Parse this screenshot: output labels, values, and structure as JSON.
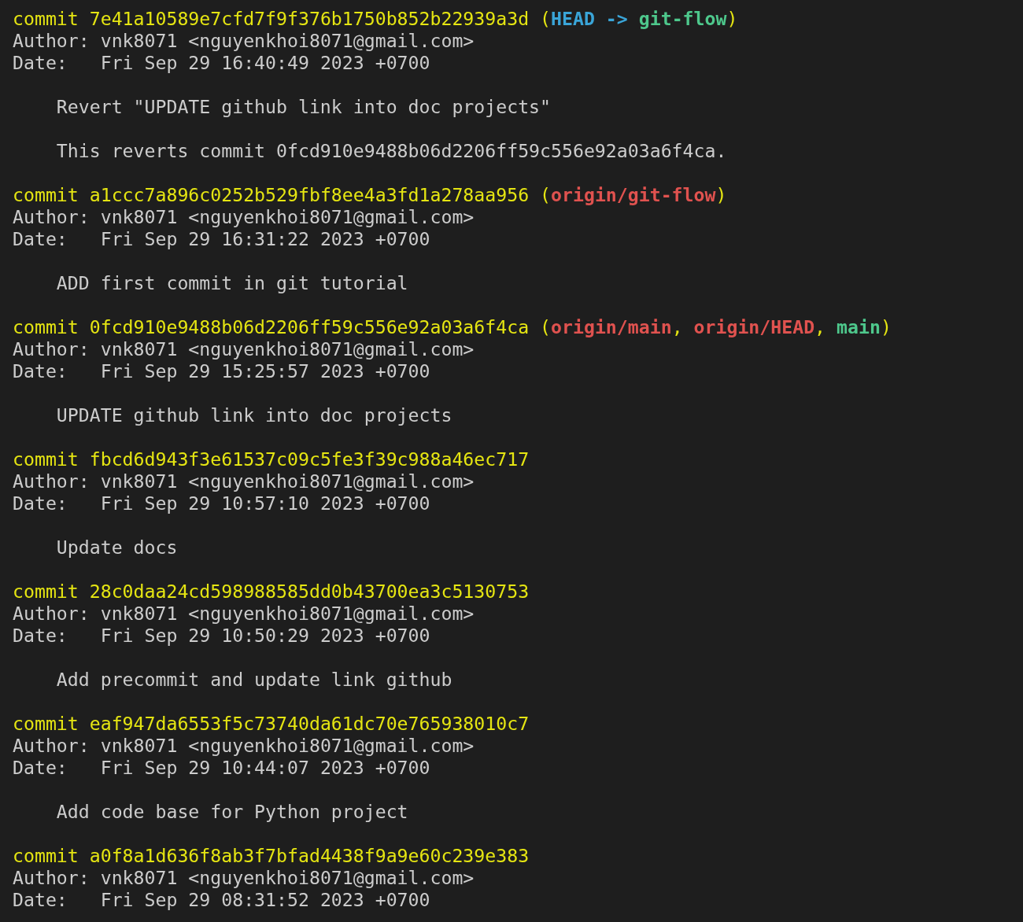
{
  "commits": [
    {
      "header": [
        {
          "kind": "hash",
          "text": "commit 7e41a10589e7cfd7f9f376b1750b852b22939a3d "
        },
        {
          "kind": "punct",
          "text": "("
        },
        {
          "kind": "head",
          "text": "HEAD -> "
        },
        {
          "kind": "local",
          "text": "git-flow"
        },
        {
          "kind": "punct",
          "text": ")"
        }
      ],
      "author": "Author: vnk8071 <nguyenkhoi8071@gmail.com>",
      "date": "Date:   Fri Sep 29 16:40:49 2023 +0700",
      "message": [
        "Revert \"UPDATE github link into doc projects\"",
        "This reverts commit 0fcd910e9488b06d2206ff59c556e92a03a6f4ca."
      ]
    },
    {
      "header": [
        {
          "kind": "hash",
          "text": "commit a1ccc7a896c0252b529fbf8ee4a3fd1a278aa956 "
        },
        {
          "kind": "punct",
          "text": "("
        },
        {
          "kind": "remote",
          "text": "origin/git-flow"
        },
        {
          "kind": "punct",
          "text": ")"
        }
      ],
      "author": "Author: vnk8071 <nguyenkhoi8071@gmail.com>",
      "date": "Date:   Fri Sep 29 16:31:22 2023 +0700",
      "message": [
        "ADD first commit in git tutorial"
      ]
    },
    {
      "header": [
        {
          "kind": "hash",
          "text": "commit 0fcd910e9488b06d2206ff59c556e92a03a6f4ca "
        },
        {
          "kind": "punct",
          "text": "("
        },
        {
          "kind": "remote",
          "text": "origin/main"
        },
        {
          "kind": "punct",
          "text": ", "
        },
        {
          "kind": "remote",
          "text": "origin/HEAD"
        },
        {
          "kind": "punct",
          "text": ", "
        },
        {
          "kind": "local",
          "text": "main"
        },
        {
          "kind": "punct",
          "text": ")"
        }
      ],
      "author": "Author: vnk8071 <nguyenkhoi8071@gmail.com>",
      "date": "Date:   Fri Sep 29 15:25:57 2023 +0700",
      "message": [
        "UPDATE github link into doc projects"
      ]
    },
    {
      "header": [
        {
          "kind": "hash",
          "text": "commit fbcd6d943f3e61537c09c5fe3f39c988a46ec717"
        }
      ],
      "author": "Author: vnk8071 <nguyenkhoi8071@gmail.com>",
      "date": "Date:   Fri Sep 29 10:57:10 2023 +0700",
      "message": [
        "Update docs"
      ]
    },
    {
      "header": [
        {
          "kind": "hash",
          "text": "commit 28c0daa24cd598988585dd0b43700ea3c5130753"
        }
      ],
      "author": "Author: vnk8071 <nguyenkhoi8071@gmail.com>",
      "date": "Date:   Fri Sep 29 10:50:29 2023 +0700",
      "message": [
        "Add precommit and update link github"
      ]
    },
    {
      "header": [
        {
          "kind": "hash",
          "text": "commit eaf947da6553f5c73740da61dc70e765938010c7"
        }
      ],
      "author": "Author: vnk8071 <nguyenkhoi8071@gmail.com>",
      "date": "Date:   Fri Sep 29 10:44:07 2023 +0700",
      "message": [
        "Add code base for Python project"
      ]
    },
    {
      "header": [
        {
          "kind": "hash",
          "text": "commit a0f8a1d636f8ab3f7bfad4438f9a9e60c239e383"
        }
      ],
      "author": "Author: vnk8071 <nguyenkhoi8071@gmail.com>",
      "date": "Date:   Fri Sep 29 08:31:52 2023 +0700"
    }
  ]
}
